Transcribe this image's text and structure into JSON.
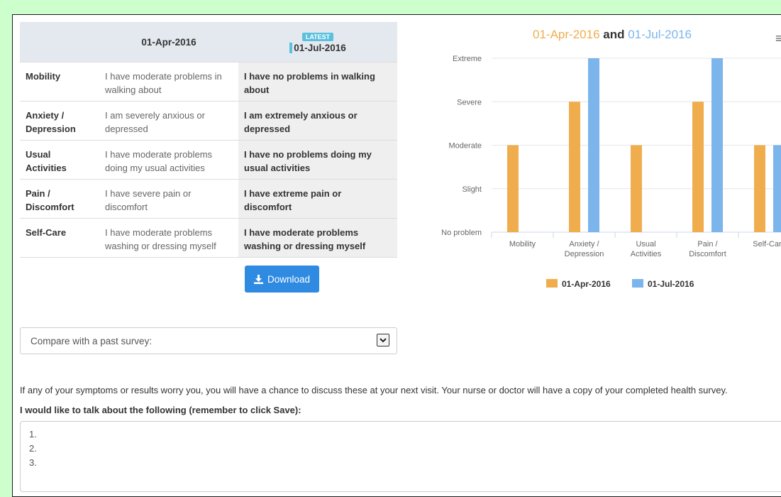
{
  "table": {
    "columns": [
      "",
      "01-Apr-2016",
      "01-Jul-2016"
    ],
    "latest_badge": "LATEST",
    "rows": [
      {
        "dimension": "Mobility",
        "old": "I have moderate problems in walking about",
        "new": "I have no problems in walking about"
      },
      {
        "dimension": "Anxiety / Depression",
        "old": "I am severely anxious or depressed",
        "new": "I am extremely anxious or depressed"
      },
      {
        "dimension": "Usual Activities",
        "old": "I have moderate problems doing my usual activities",
        "new": "I have no problems doing my usual activities"
      },
      {
        "dimension": "Pain / Discomfort",
        "old": "I have severe pain or discomfort",
        "new": "I have extreme pain or discomfort"
      },
      {
        "dimension": "Self-Care",
        "old": "I have moderate problems washing or dressing myself",
        "new": "I have moderate problems washing or dressing myself"
      }
    ]
  },
  "download_label": "Download",
  "compare_select": {
    "value": "Compare with a past survey:"
  },
  "info_text": "If any of your symptoms or results worry you, you will have a chance to discuss these at your next visit. Your nurse or doctor will have a copy of your completed health survey.",
  "talk_label": "I would like to talk about the following (remember to click Save):",
  "talk_value": "1.\n2.\n3.",
  "colors": {
    "series1": "#f0ad4e",
    "series2": "#7cb5ec",
    "badge": "#5bc0de",
    "button": "#2f8be2",
    "background": "#ccffcc"
  },
  "icons": {
    "download": "download-icon",
    "menu": "hamburger-menu-icon",
    "dropdown": "chevron-down-icon"
  },
  "chart_data": {
    "type": "bar",
    "title_parts": [
      "01-Apr-2016",
      " and ",
      "01-Jul-2016"
    ],
    "categories": [
      [
        "Mobility"
      ],
      [
        "Anxiety /",
        "Depression"
      ],
      [
        "Usual",
        "Activities"
      ],
      [
        "Pain /",
        "Discomfort"
      ],
      [
        "Self-Care"
      ]
    ],
    "y_levels": [
      "No problem",
      "Slight",
      "Moderate",
      "Severe",
      "Extreme"
    ],
    "ylim": [
      0,
      4
    ],
    "series": [
      {
        "name": "01-Apr-2016",
        "values": [
          2,
          3,
          2,
          3,
          2
        ]
      },
      {
        "name": "01-Jul-2016",
        "values": [
          0,
          4,
          0,
          4,
          2
        ]
      }
    ],
    "legend": "bottom-center",
    "grid": true
  }
}
